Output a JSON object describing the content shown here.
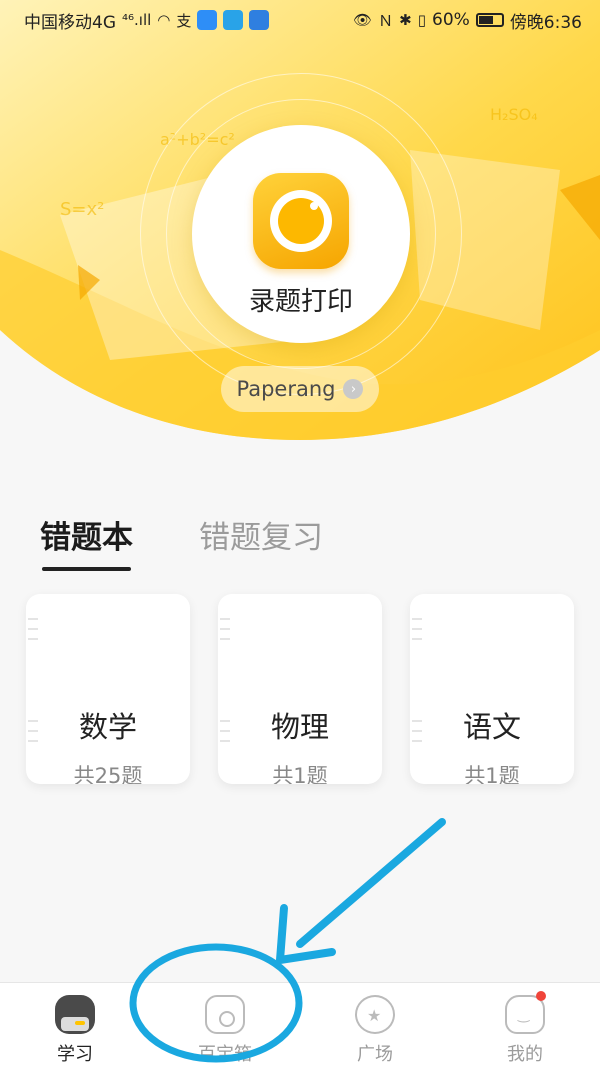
{
  "status_bar": {
    "carrier": "中国移动4G",
    "signal": "⁴⁶.ıll",
    "battery": "60%",
    "time": "傍晚6:36"
  },
  "hero": {
    "capture_label": "录题打印",
    "brand_label": "Paperang",
    "chevron": "›"
  },
  "tabs": [
    {
      "label": "错题本",
      "active": true
    },
    {
      "label": "错题复习",
      "active": false
    }
  ],
  "cards": [
    {
      "subject": "数学",
      "count": "共25题"
    },
    {
      "subject": "物理",
      "count": "共1题"
    },
    {
      "subject": "语文",
      "count": "共1题"
    }
  ],
  "bottom_nav": [
    {
      "label": "学习",
      "icon": "study-icon",
      "active": true
    },
    {
      "label": "百宝箱",
      "icon": "toolbox-icon",
      "active": false
    },
    {
      "label": "广场",
      "icon": "plaza-icon",
      "active": false
    },
    {
      "label": "我的",
      "icon": "profile-icon",
      "active": false,
      "badge": true
    }
  ],
  "colors": {
    "accent_yellow": "#ffc21a",
    "annotation_blue": "#1aa8e0",
    "badge_red": "#f0443a"
  }
}
